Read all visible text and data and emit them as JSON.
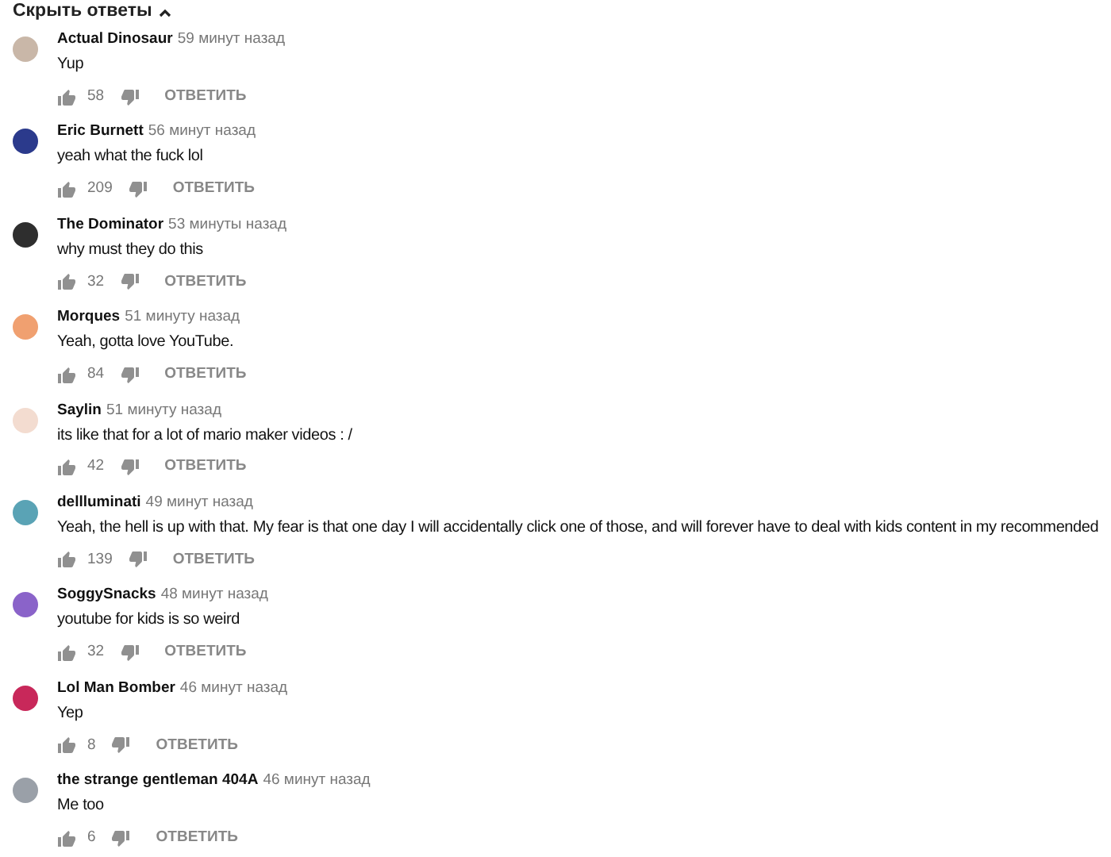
{
  "toggle": {
    "label": "Скрыть ответы",
    "expanded": true
  },
  "comments": [
    {
      "author": "Actual Dinosaur",
      "time": "59 минут назад",
      "text": "Yup",
      "likes": "58",
      "reply": "ОТВЕТИТЬ",
      "color": "#c9b7a8"
    },
    {
      "author": "Eric Burnett",
      "time": "56 минут назад",
      "text": "yeah what the fuck lol",
      "likes": "209",
      "reply": "ОТВЕТИТЬ",
      "color": "#2b3a8c"
    },
    {
      "author": "The Dominator",
      "time": "53 минуты назад",
      "text": "why must they do this",
      "likes": "32",
      "reply": "ОТВЕТИТЬ",
      "color": "#2e2e2e"
    },
    {
      "author": "Morques",
      "time": "51 минуту назад",
      "text": "Yeah, gotta love YouTube.",
      "likes": "84",
      "reply": "ОТВЕТИТЬ",
      "color": "#f0a070"
    },
    {
      "author": "Saylin",
      "time": "51 минуту назад",
      "text": "its like that for a lot of mario maker videos : /",
      "likes": "42",
      "reply": "ОТВЕТИТЬ",
      "color": "#f3dcd0"
    },
    {
      "author": "dellluminati",
      "time": "49 минут назад",
      "text": "Yeah, the hell is up with that. My fear is that one day I will accidentally click one of those, and will forever have to deal with kids content in my recommended",
      "likes": "139",
      "reply": "ОТВЕТИТЬ",
      "color": "#5aa3b5"
    },
    {
      "author": "SoggySnacks",
      "time": "48 минут назад",
      "text": "youtube for kids is so weird",
      "likes": "32",
      "reply": "ОТВЕТИТЬ",
      "color": "#8a63c9"
    },
    {
      "author": "Lol Man Bomber",
      "time": "46 минут назад",
      "text": "Yep",
      "likes": "8",
      "reply": "ОТВЕТИТЬ",
      "color": "#c8285a"
    },
    {
      "author": "the strange gentleman 404A",
      "time": "46 минут назад",
      "text": "Me too",
      "likes": "6",
      "reply": "ОТВЕТИТЬ",
      "color": "#9aa0a8"
    }
  ]
}
